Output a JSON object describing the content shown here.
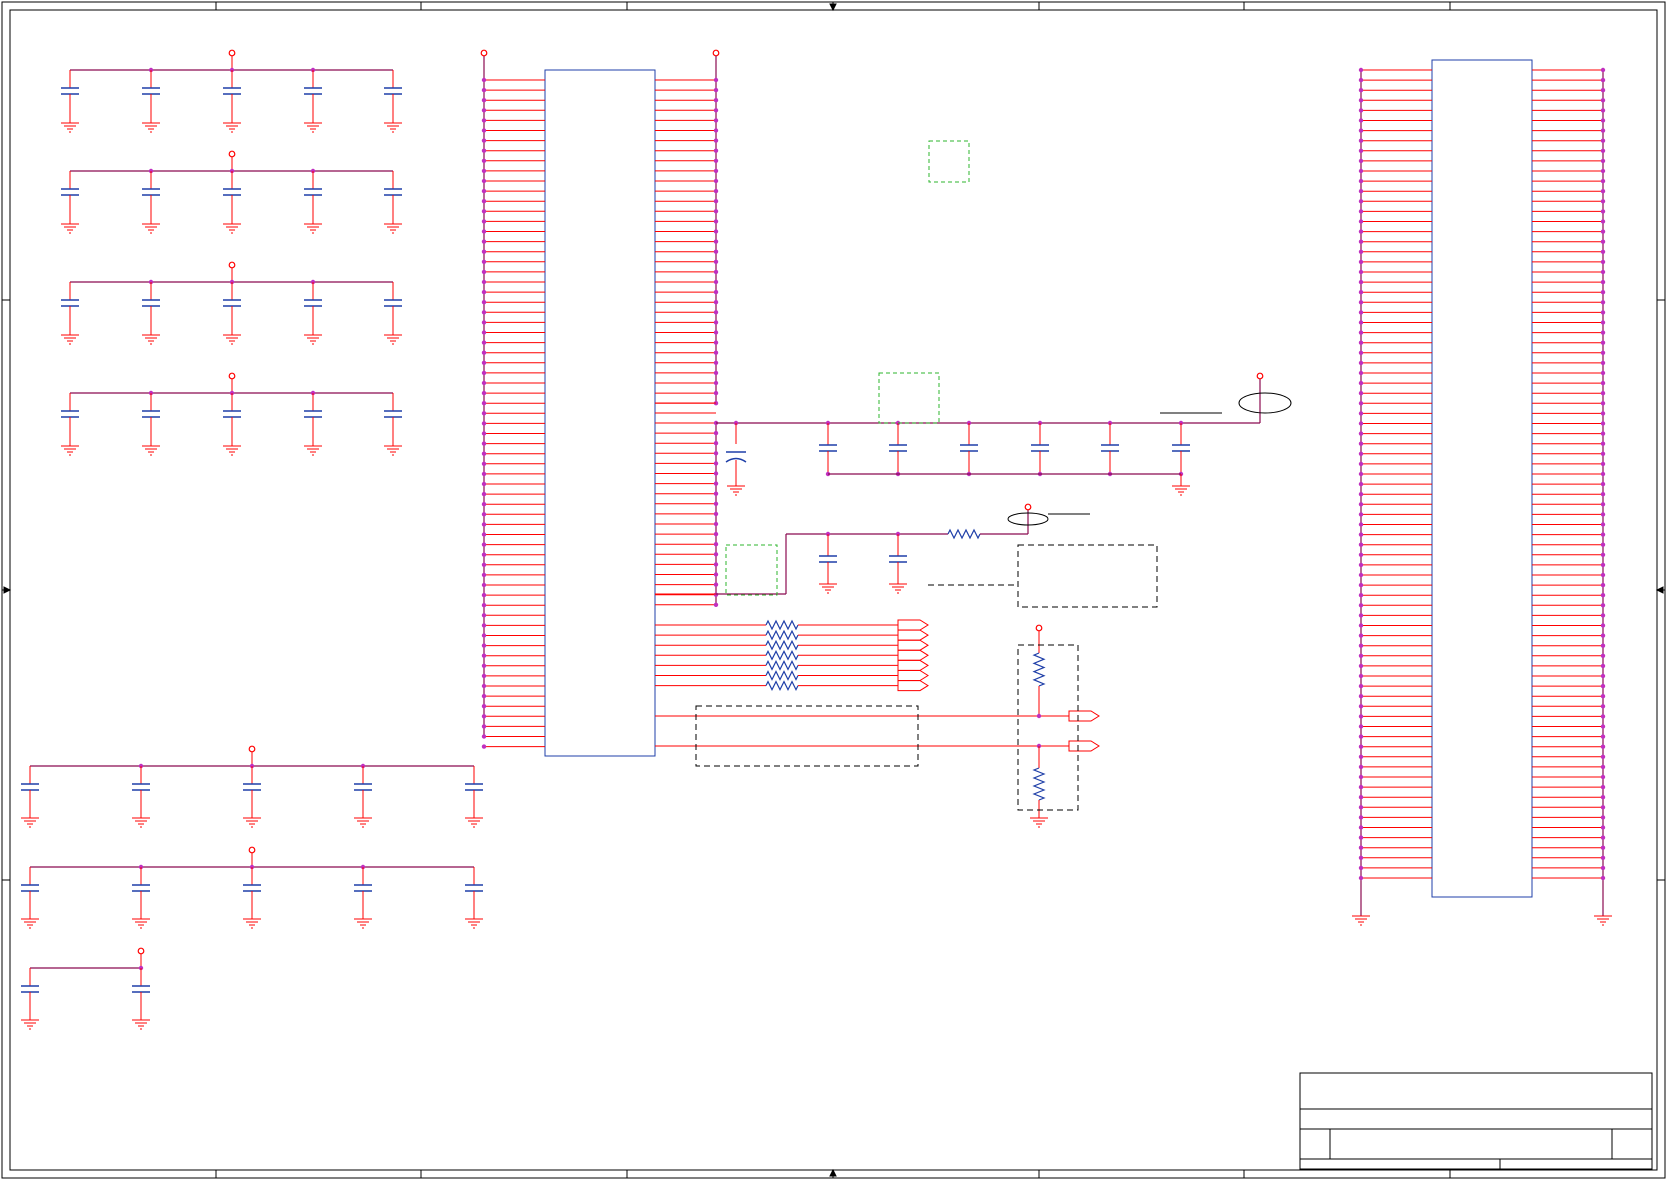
{
  "colors": {
    "background": "#ffffff",
    "frame": "#000000",
    "wire": "#8b0a50",
    "pin": "#ff0000",
    "component": "#1f3fa8",
    "junction": "#c030c0",
    "ground": "#ff0000",
    "highlight_box": "#2db52d",
    "annotation_box": "#000000",
    "title_block": "#000000"
  },
  "sheet": {
    "decoupling_cap_banks": 7,
    "main_ic_count": 1,
    "connector_count": 1,
    "resistor_array_count": 7,
    "off_page_connectors": 9
  }
}
